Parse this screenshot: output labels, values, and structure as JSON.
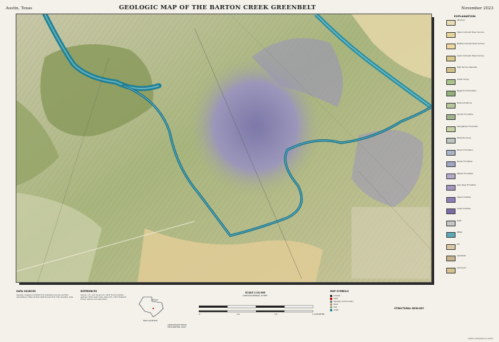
{
  "header": {
    "place": "Austin, Texas",
    "title": "GEOLOGIC MAP OF THE BARTON CREEK GREENBELT",
    "date": "November 2023"
  },
  "legend": {
    "title": "EXPLANATION",
    "units": [
      {
        "label": "Alluvium",
        "color": "#e9dcb3"
      },
      {
        "label": "Upper Colorado River terrace",
        "color": "#e7d39a"
      },
      {
        "label": "Middle Colorado River terrace",
        "color": "#efd9a0"
      },
      {
        "label": "Lower Colorado River terrace",
        "color": "#d9c98a"
      },
      {
        "label": "High terrace deposits",
        "color": "#cfbf86"
      },
      {
        "label": "Austin Group",
        "color": "#a9c48a"
      },
      {
        "label": "Eagle Ford Formation",
        "color": "#93b07a"
      },
      {
        "label": "Buda Limestone",
        "color": "#b7c59a"
      },
      {
        "label": "Del Rio Formation",
        "color": "#9fb38b"
      },
      {
        "label": "Georgetown Formation",
        "color": "#c8d3a3"
      },
      {
        "label": "Edwards Group",
        "color": "#bcc7c1"
      },
      {
        "label": "Person Formation",
        "color": "#a8b4c7"
      },
      {
        "label": "Kainer Formation",
        "color": "#9fa6c4"
      },
      {
        "label": "Walnut Formation",
        "color": "#b4a9c8"
      },
      {
        "label": "Glen Rose Formation",
        "color": "#a496c0"
      },
      {
        "label": "Upper member",
        "color": "#8c7fb8"
      },
      {
        "label": "Lower member",
        "color": "#7b6ca8"
      },
      {
        "label": "Fault",
        "color": "#c6c6c6"
      },
      {
        "label": "Water",
        "color": "#5aa8b8"
      },
      {
        "label": "Fill",
        "color": "#d8c7a0"
      },
      {
        "label": "Landslide",
        "color": "#c8b48c"
      },
      {
        "label": "Colluvium",
        "color": "#d6c28e"
      }
    ]
  },
  "colors": {
    "water": "#1f7f93",
    "water_light": "#5fb6c4",
    "terrain": "#a9b87f",
    "terrain_dark": "#6f7d4f",
    "limestone": "#8f88b4",
    "terrace": "#e2cd96"
  },
  "footer": {
    "index_heading": "DATA SOURCES",
    "index_text": "Geologic mapping modified from published sources and field observations. Base shaded relief derived from lidar elevation data.",
    "refs_heading": "REFERENCES",
    "refs_text": "Garner, L.E., and Young, K.P., 1976, Environmental geology of the Austin area. Rose, P.R., 1972, Edwards Group, surface and subsurface.",
    "loc_label": "MAP LOCATION",
    "state_label": "TEXAS",
    "decl_label": "APPROXIMATE MEAN DECLINATION, 2023",
    "scale_title": "SCALE 1:10,000",
    "scale_sub": "CONTOUR INTERVAL 10 FEET",
    "scale_miles": [
      "0",
      "1/4",
      "1/2",
      "1 KILOMETER"
    ],
    "symbols_heading": "MAP SYMBOLS",
    "symbols": [
      "Contact",
      "Fault",
      "Geologic unit boundary",
      "Road",
      "Trail",
      "Creek"
    ],
    "explanation_heading": "STRUCTURAL GEOLOGY",
    "credit": "Digital cartography by author"
  }
}
